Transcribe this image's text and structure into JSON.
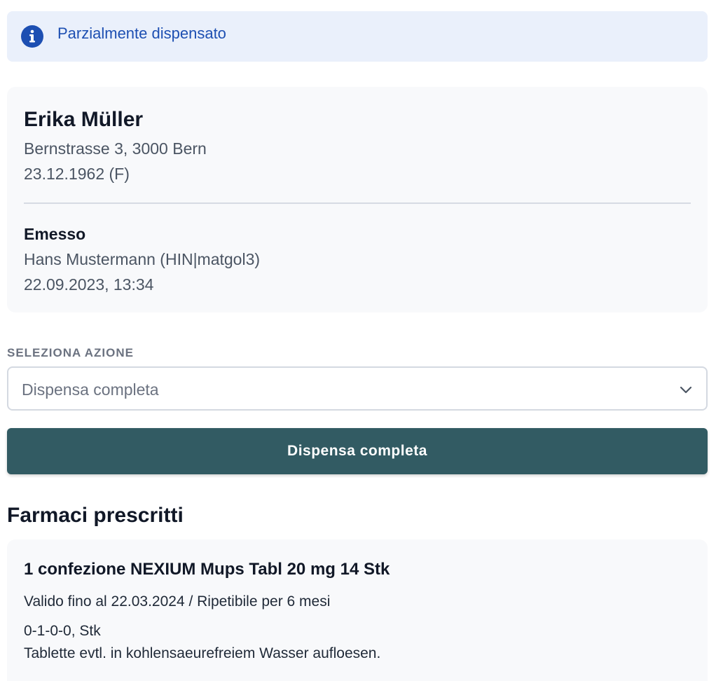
{
  "status_banner": {
    "text": "Parzialmente dispensato",
    "icon": "info-icon",
    "color": "#1d4fb2",
    "background": "#eaf0fb"
  },
  "patient": {
    "name": "Erika Müller",
    "address": "Bernstrasse 3, 3000 Bern",
    "birth": "23.12.1962 (F)"
  },
  "issuer": {
    "heading": "Emesso",
    "name": "Hans Mustermann (HIN|matgol3)",
    "datetime": "22.09.2023, 13:34"
  },
  "action": {
    "label": "SELEZIONA AZIONE",
    "selected": "Dispensa completa",
    "icon": "chevron-down-icon"
  },
  "primary_button": {
    "label": "Dispensa completa",
    "color": "#325b63"
  },
  "medications": {
    "title": "Farmaci prescritti",
    "items": [
      {
        "title": "1 confezione NEXIUM Mups Tabl 20 mg 14 Stk",
        "validity": "Valido fino al 22.03.2024 / Ripetibile per 6 mesi",
        "dosage": "0-1-0-0, Stk",
        "instructions": "Tablette evtl. in kohlensaeurefreiem Wasser aufloesen."
      }
    ]
  }
}
